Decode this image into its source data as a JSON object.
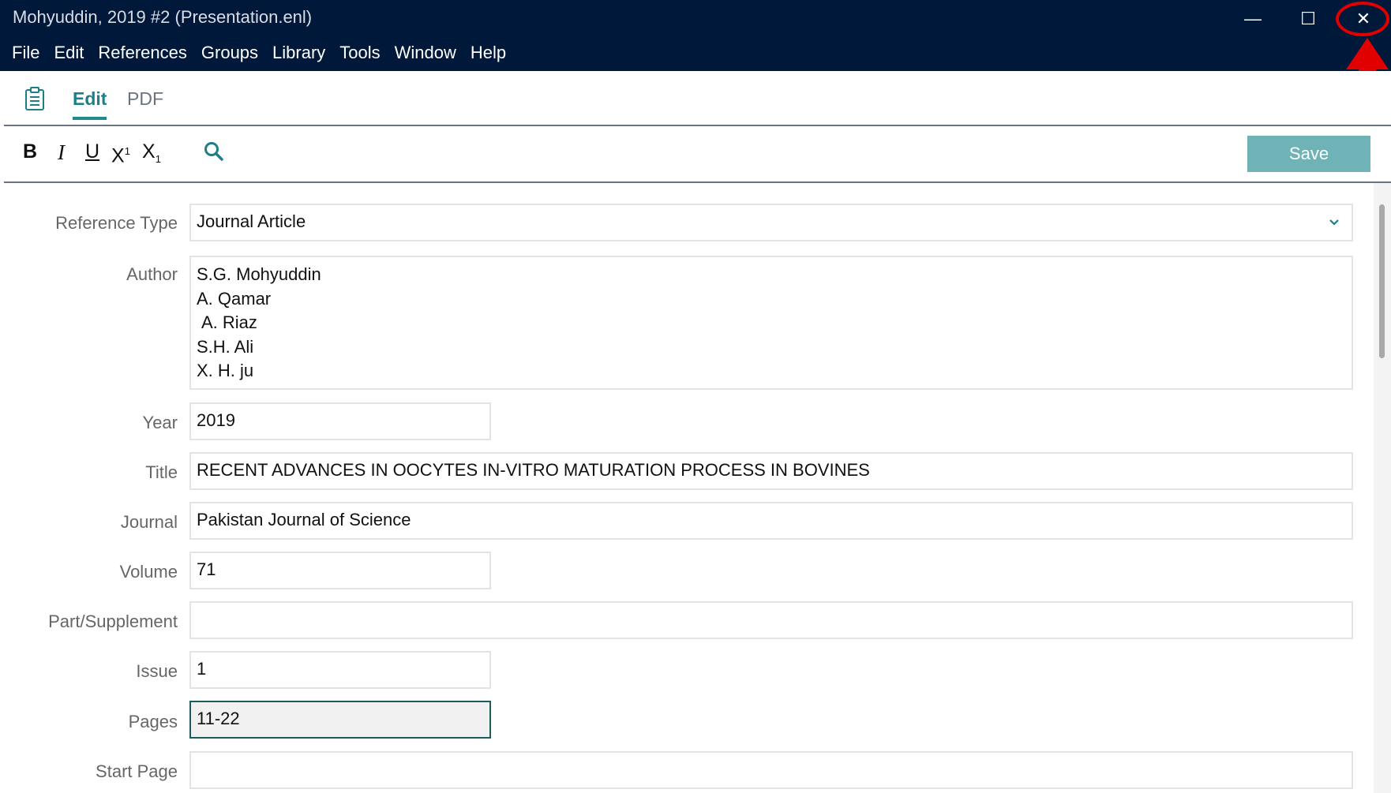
{
  "window": {
    "title": "Mohyuddin, 2019 #2 (Presentation.enl)",
    "controls": {
      "minimize": "—",
      "maximize": "☐",
      "close": "✕"
    }
  },
  "menu": {
    "items": [
      "File",
      "Edit",
      "References",
      "Groups",
      "Library",
      "Tools",
      "Window",
      "Help"
    ]
  },
  "tabs": {
    "icon": "clipboard-icon",
    "items": [
      {
        "label": "Edit",
        "active": true
      },
      {
        "label": "PDF",
        "active": false
      }
    ]
  },
  "toolbar": {
    "bold": "B",
    "italic": "I",
    "underline": "U",
    "superscript_base": "X",
    "superscript_mark": "1",
    "subscript_base": "X",
    "subscript_mark": "1",
    "search_icon": "search-icon",
    "save_label": "Save"
  },
  "fields": {
    "reference_type": {
      "label": "Reference Type",
      "value": "Journal Article"
    },
    "author": {
      "label": "Author",
      "lines": [
        "S.G. Mohyuddin",
        "A. Qamar",
        "A. Riaz",
        "S.H. Ali",
        "X. H. ju"
      ]
    },
    "year": {
      "label": "Year",
      "value": "2019"
    },
    "title": {
      "label": "Title",
      "value": "RECENT ADVANCES IN OOCYTES IN-VITRO MATURATION PROCESS IN BOVINES"
    },
    "journal": {
      "label": "Journal",
      "value": "Pakistan Journal of Science"
    },
    "volume": {
      "label": "Volume",
      "value": "71"
    },
    "part_supplement": {
      "label": "Part/Supplement",
      "value": ""
    },
    "issue": {
      "label": "Issue",
      "value": "1"
    },
    "pages": {
      "label": "Pages",
      "value": "11-22"
    },
    "start_page": {
      "label": "Start Page",
      "value": ""
    }
  },
  "colors": {
    "titlebar": "#00183a",
    "accent": "#1f8a92",
    "save_button": "#6fb3b7",
    "annotation": "#e00000"
  }
}
